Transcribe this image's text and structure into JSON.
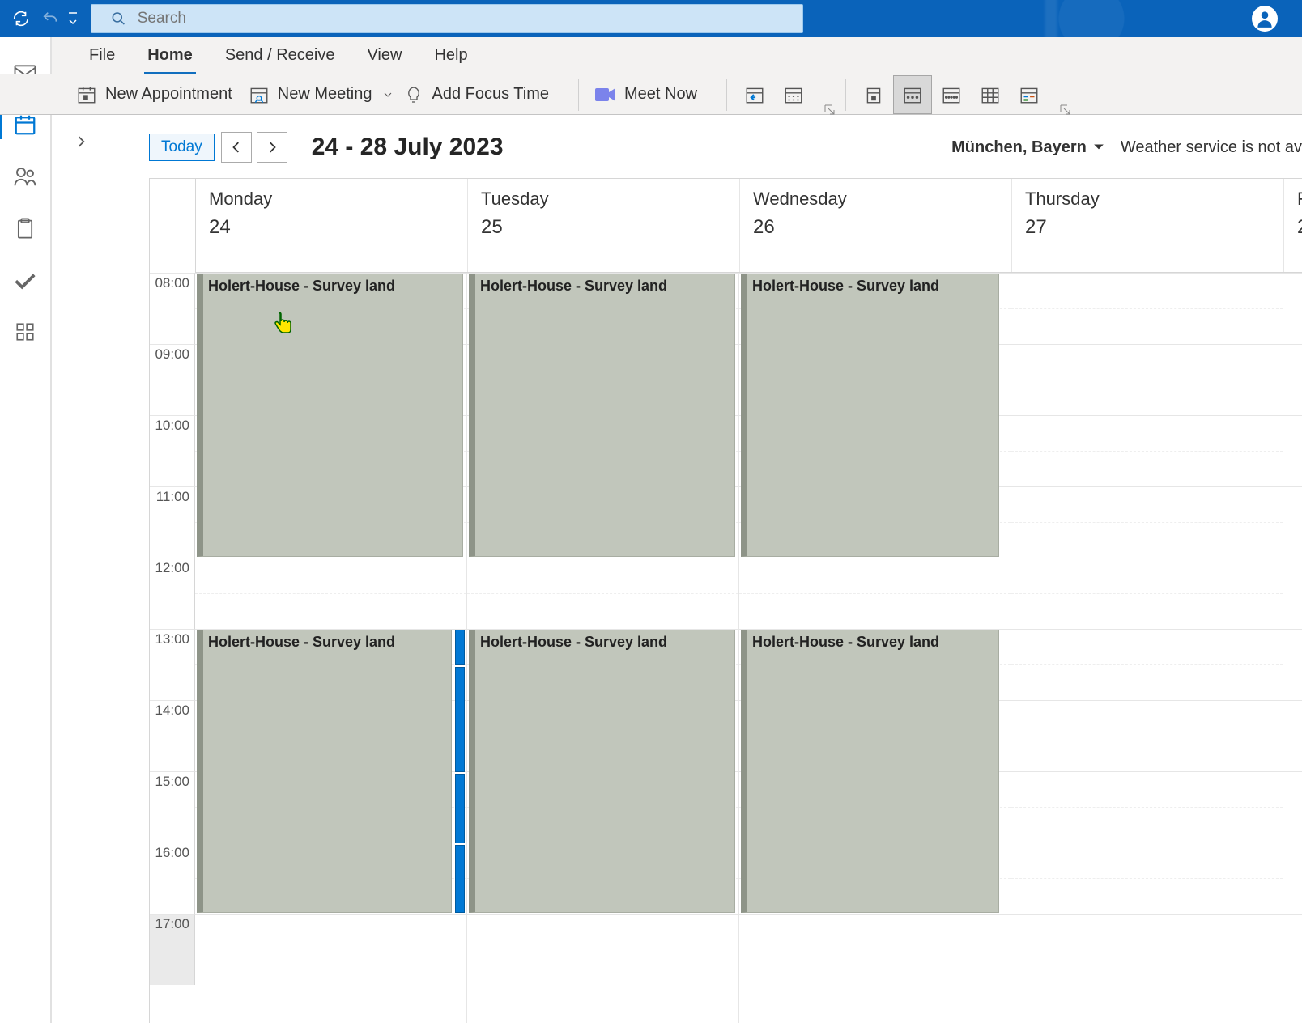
{
  "search": {
    "placeholder": "Search"
  },
  "tabs": {
    "file": "File",
    "home": "Home",
    "sendreceive": "Send / Receive",
    "view": "View",
    "help": "Help"
  },
  "ribbon": {
    "new_appointment": "New Appointment",
    "new_meeting": "New Meeting",
    "add_focus": "Add Focus Time",
    "meet_now": "Meet Now"
  },
  "calnav": {
    "today": "Today",
    "range": "24 - 28 July 2023",
    "location": "München, Bayern",
    "weather_msg": "Weather service is not av"
  },
  "days": [
    {
      "name": "Monday",
      "num": "24"
    },
    {
      "name": "Tuesday",
      "num": "25"
    },
    {
      "name": "Wednesday",
      "num": "26"
    },
    {
      "name": "Thursday",
      "num": "27"
    },
    {
      "name": "F",
      "num": "2"
    }
  ],
  "hours": [
    "08:00",
    "09:00",
    "10:00",
    "11:00",
    "12:00",
    "13:00",
    "14:00",
    "15:00",
    "16:00",
    "17:00"
  ],
  "event_title": "Holert-House - Survey land"
}
